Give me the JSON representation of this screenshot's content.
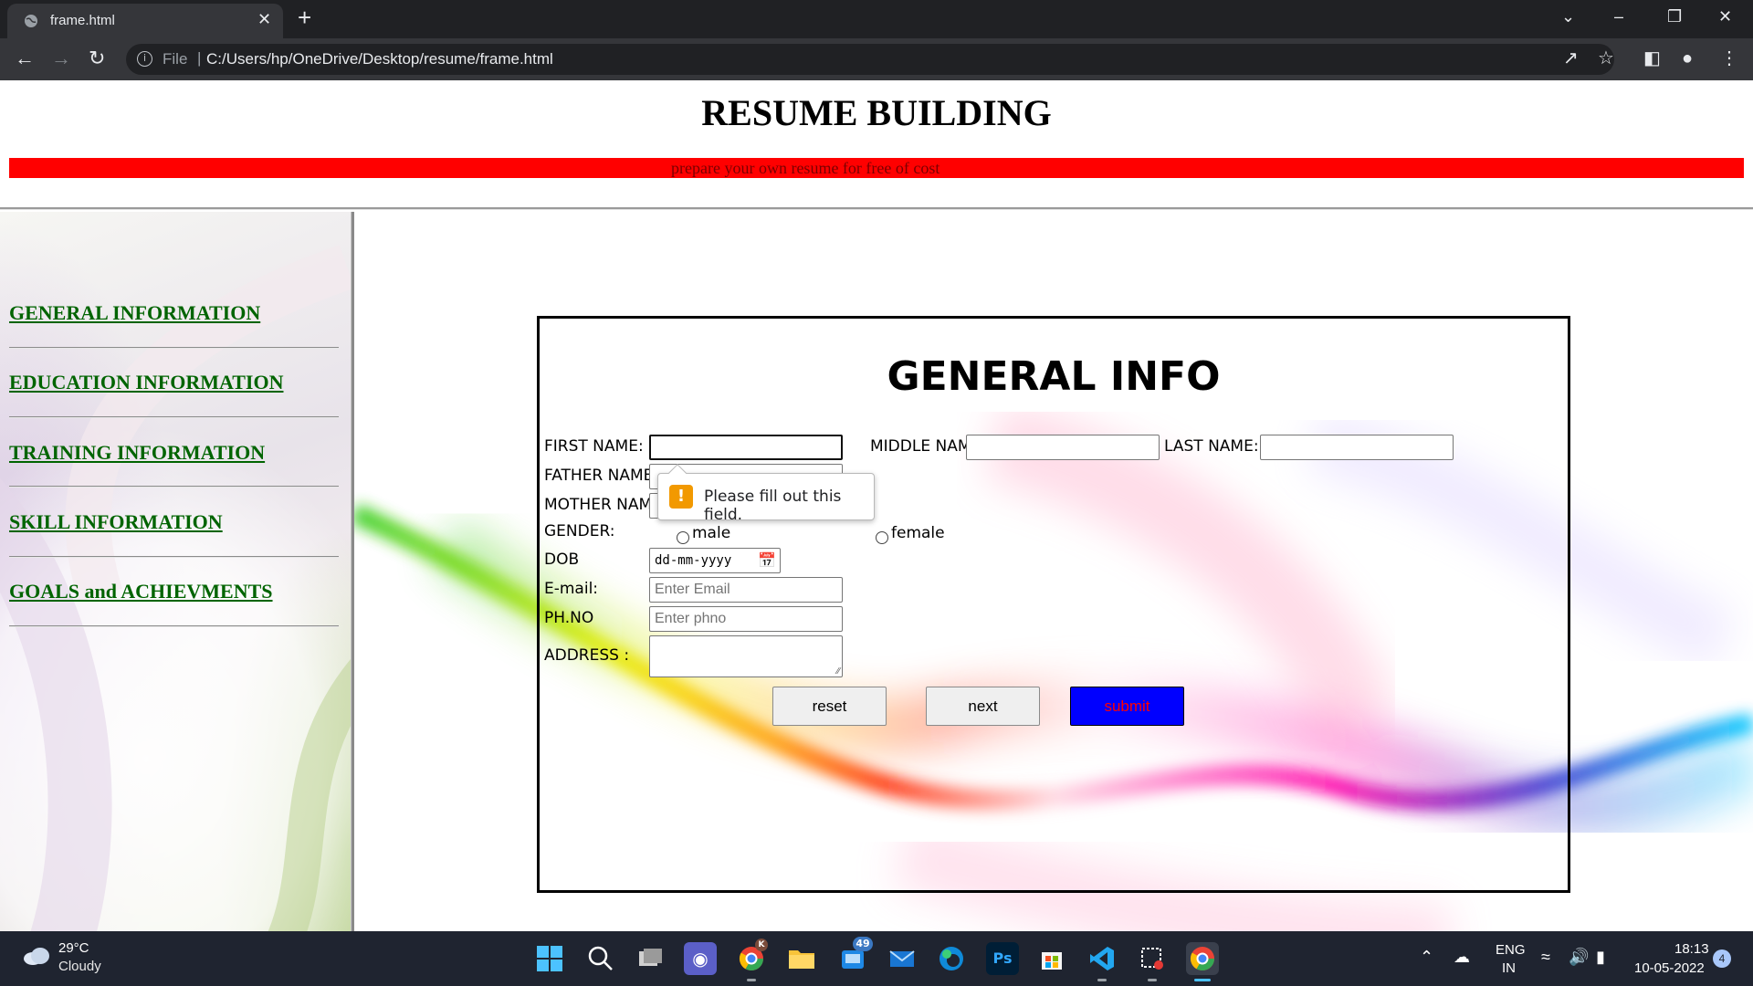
{
  "browser": {
    "tab_title": "frame.html",
    "tab_close": "✕",
    "new_tab": "+",
    "file_label": "File",
    "url_separator": "|",
    "url": "C:/Users/hp/OneDrive/Desktop/resume/frame.html",
    "window_controls": [
      "⌄",
      "–",
      "❐",
      "✕"
    ]
  },
  "page": {
    "title": "RESUME BUILDING",
    "banner_text": "prepare your own resume for free of cost"
  },
  "sidebar": {
    "items": [
      {
        "label": "GENERAL INFORMATION"
      },
      {
        "label": "EDUCATION INFORMATION"
      },
      {
        "label": "TRAINING INFORMATION"
      },
      {
        "label": "SKILL INFORMATION"
      },
      {
        "label": "GOALS and ACHIEVMENTS"
      }
    ]
  },
  "form": {
    "heading": "GENERAL INFO",
    "first_name_label": "FIRST NAME:",
    "first_name_value": "",
    "middle_name_label": "MIDDLE NAME",
    "middle_name_value": "",
    "last_name_label": "LAST NAME:",
    "last_name_value": "",
    "father_name_label": "FATHER NAME:",
    "mother_name_label": "MOTHER NAME",
    "gender_label": "GENDER:",
    "gender_options": [
      "male",
      "female"
    ],
    "dob_label": "DOB",
    "dob_placeholder": "dd-mm-yyyy",
    "email_label": "E-mail:",
    "email_placeholder": "Enter Email",
    "phone_label": "PH.NO",
    "phone_placeholder": "Enter phno",
    "address_label": "ADDRESS :",
    "reset_label": "reset",
    "next_label": "next",
    "submit_label": "submit"
  },
  "validation": {
    "message": "Please fill out this field.",
    "icon": "!",
    "icon_color": "#f29900"
  },
  "taskbar": {
    "weather_temp": "29°C",
    "weather_desc": "Cloudy",
    "apps": [
      "start-icon",
      "search-icon",
      "task-view-icon",
      "chat-icon",
      "chrome-icon",
      "file-explorer-icon",
      "mail-badge-icon",
      "mail-icon",
      "edge-icon",
      "photoshop-icon",
      "store-icon",
      "vscode-icon",
      "snipping-tool-icon",
      "chrome-active-icon"
    ],
    "mail_badge": "49",
    "chrome_badge": "K",
    "ps_label": "Ps",
    "lang_line1": "ENG",
    "lang_line2": "IN",
    "time": "18:13",
    "date": "10-05-2022",
    "notification_count": "4"
  },
  "colors": {
    "banner": "#ff0000",
    "nav_link": "#006400",
    "submit_bg": "#0000ff",
    "submit_text": "#ff0000"
  }
}
